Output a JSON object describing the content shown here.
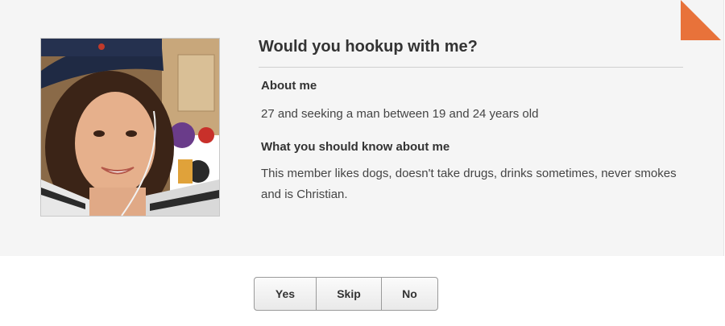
{
  "profile": {
    "title": "Would you hookup with me?",
    "photo_alt": "profile-photo"
  },
  "about": {
    "heading": "About me",
    "text": "27 and seeking a man between 19 and 24 years old"
  },
  "know": {
    "heading": "What you should know about me",
    "text": "This member likes dogs, doesn't take drugs, drinks sometimes, never smokes and is Christian."
  },
  "actions": {
    "yes_label": "Yes",
    "skip_label": "Skip",
    "no_label": "No"
  },
  "colors": {
    "card_background": "#f5f5f5",
    "corner_flag": "#e8723a",
    "button_border": "#9a9a9a"
  },
  "icons": {
    "corner": "orange-corner-flag-icon"
  }
}
